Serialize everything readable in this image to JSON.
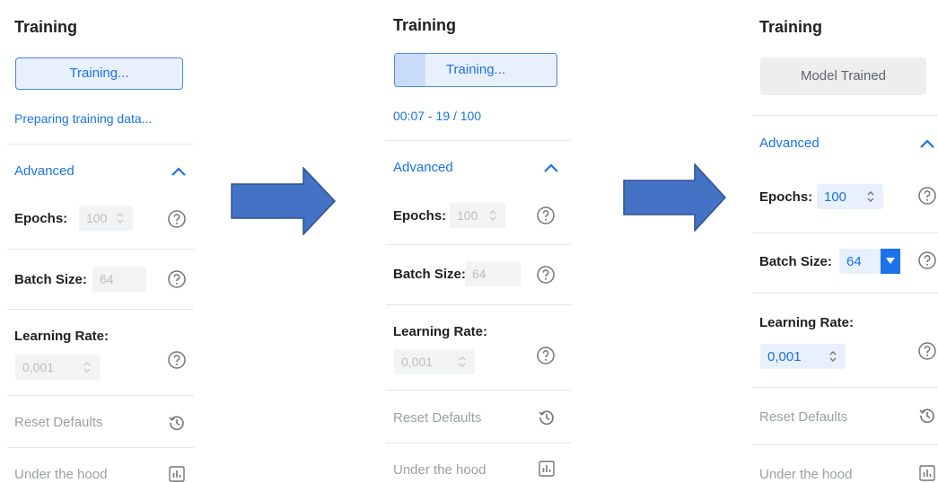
{
  "panels": [
    {
      "title": "Training",
      "button_label": "Training...",
      "status": "Preparing training data...",
      "advanced": "Advanced",
      "epochs_label": "Epochs:",
      "epochs_value": "100",
      "batch_label": "Batch Size:",
      "batch_value": "64",
      "lr_label": "Learning Rate:",
      "lr_value": "0,001",
      "reset": "Reset Defaults",
      "hood": "Under the hood"
    },
    {
      "title": "Training",
      "button_label": "Training...",
      "progress": 0.19,
      "status": "00:07 - 19 / 100",
      "advanced": "Advanced",
      "epochs_label": "Epochs:",
      "epochs_value": "100",
      "batch_label": "Batch Size:",
      "batch_value": "64",
      "lr_label": "Learning Rate:",
      "lr_value": "0,001",
      "reset": "Reset Defaults",
      "hood": "Under the hood"
    },
    {
      "title": "Training",
      "button_label": "Model Trained",
      "advanced": "Advanced",
      "epochs_label": "Epochs:",
      "epochs_value": "100",
      "batch_label": "Batch Size:",
      "batch_value": "64",
      "lr_label": "Learning Rate:",
      "lr_value": "0,001",
      "reset": "Reset Defaults",
      "hood": "Under the hood"
    }
  ],
  "icons": {
    "help": "help-circle-icon",
    "spinner": "up-down-stepper-icon",
    "dropdown": "dropdown-arrow-icon",
    "history": "history-icon",
    "chart": "bar-chart-icon",
    "chevron": "chevron-up-icon",
    "arrow": "right-arrow-icon"
  },
  "colors": {
    "accent": "#1a73e8",
    "arrow_fill": "#4472c4",
    "arrow_stroke": "#2f528f",
    "disabled_text": "#bdbdbd",
    "muted_text": "#9aa0a6"
  }
}
